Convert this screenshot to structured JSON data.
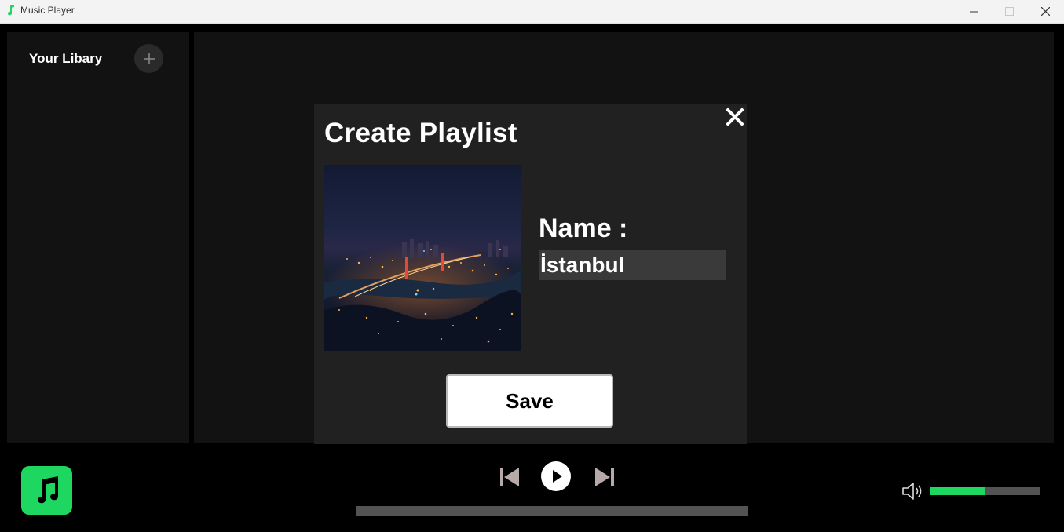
{
  "window": {
    "title": "Music Player",
    "icon": "music-note-icon"
  },
  "library": {
    "title": "Your Libary",
    "add_icon": "plus-icon"
  },
  "dialog": {
    "title": "Create Playlist",
    "name_label": "Name :",
    "name_value": "İstanbul",
    "save_label": "Save",
    "cover_image": "istanbul-night-cityscape"
  },
  "player": {
    "progress": 0,
    "volume": 0.5,
    "accent_color": "#1ed760",
    "icons": [
      "previous-icon",
      "play-icon",
      "next-icon",
      "speaker-icon"
    ]
  }
}
